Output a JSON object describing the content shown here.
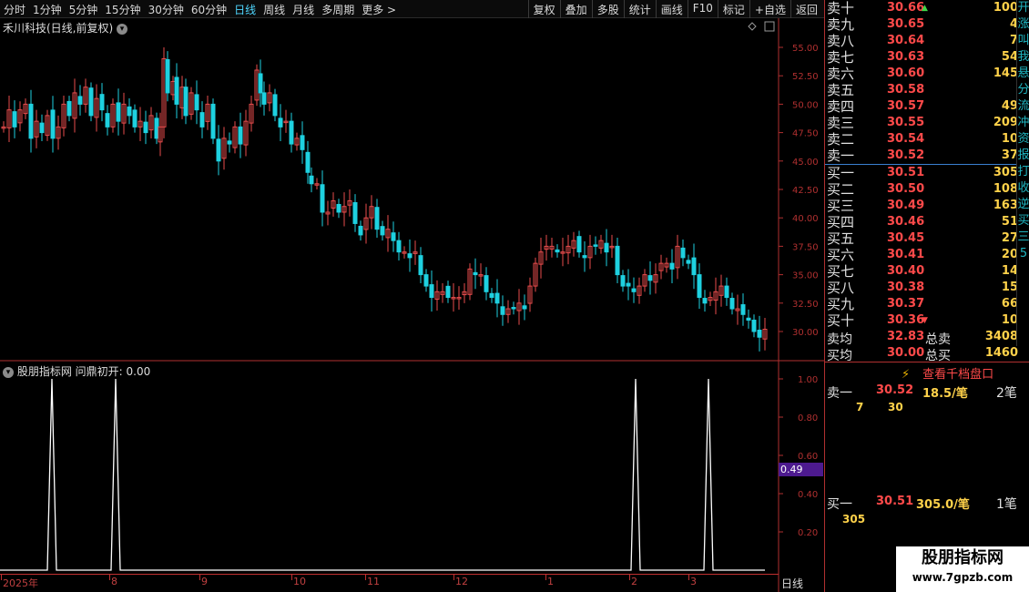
{
  "toolbar": {
    "left": [
      "分时",
      "1分钟",
      "5分钟",
      "15分钟",
      "30分钟",
      "60分钟",
      "日线",
      "周线",
      "月线",
      "多周期",
      "更多 >"
    ],
    "active": "日线",
    "right": [
      "复权",
      "叠加",
      "多股",
      "统计",
      "画线",
      "F10",
      "标记",
      "+自选",
      "返回"
    ]
  },
  "chart": {
    "title": "禾川科技(日线,前复权)",
    "y_labels": [
      "55.00",
      "52.50",
      "50.00",
      "47.50",
      "45.00",
      "42.50",
      "40.00",
      "37.50",
      "35.00",
      "32.50",
      "30.00"
    ],
    "ind_y_labels": [
      "1.00",
      "0.80",
      "0.60",
      "0.40",
      "0.20"
    ]
  },
  "indicator": {
    "title": "股朋指标网",
    "name": "问鼎初开:",
    "value": "0.00",
    "tag": "0.49"
  },
  "x_axis": {
    "labels": [
      "2025年",
      "8",
      "9",
      "10",
      "11",
      "12",
      "1",
      "2",
      "3"
    ],
    "period": "日线"
  },
  "order_book": {
    "asks": [
      {
        "name": "卖十",
        "price": "30.66",
        "vol": "100",
        "mark": "up"
      },
      {
        "name": "卖九",
        "price": "30.65",
        "vol": "4"
      },
      {
        "name": "卖八",
        "price": "30.64",
        "vol": "7"
      },
      {
        "name": "卖七",
        "price": "30.63",
        "vol": "54"
      },
      {
        "name": "卖六",
        "price": "30.60",
        "vol": "145"
      },
      {
        "name": "卖五",
        "price": "30.58",
        "vol": ""
      },
      {
        "name": "卖四",
        "price": "30.57",
        "vol": "49"
      },
      {
        "name": "卖三",
        "price": "30.55",
        "vol": "209"
      },
      {
        "name": "卖二",
        "price": "30.54",
        "vol": "10"
      },
      {
        "name": "卖一",
        "price": "30.52",
        "vol": "37"
      }
    ],
    "bids": [
      {
        "name": "买一",
        "price": "30.51",
        "vol": "305"
      },
      {
        "name": "买二",
        "price": "30.50",
        "vol": "108"
      },
      {
        "name": "买三",
        "price": "30.49",
        "vol": "163"
      },
      {
        "name": "买四",
        "price": "30.46",
        "vol": "51"
      },
      {
        "name": "买五",
        "price": "30.45",
        "vol": "27"
      },
      {
        "name": "买六",
        "price": "30.41",
        "vol": "20"
      },
      {
        "name": "买七",
        "price": "30.40",
        "vol": "14"
      },
      {
        "name": "买八",
        "price": "30.38",
        "vol": "15"
      },
      {
        "name": "买九",
        "price": "30.37",
        "vol": "66"
      },
      {
        "name": "买十",
        "price": "30.36",
        "vol": "10",
        "mark": "down"
      }
    ],
    "sell_avg_label": "卖均",
    "sell_avg": "32.83",
    "total_sell_label": "总卖",
    "total_sell": "3408",
    "buy_avg_label": "买均",
    "buy_avg": "30.00",
    "total_buy_label": "总买",
    "total_buy": "1460"
  },
  "queue": {
    "button": "查看千档盘口",
    "sell1_label": "卖一",
    "sell1_price": "30.52",
    "sell1_avg": "18.5/笔",
    "sell1_count": "2笔",
    "sell1_orders": [
      "7",
      "30"
    ],
    "buy1_label": "买一",
    "buy1_price": "30.51",
    "buy1_avg": "305.0/笔",
    "buy1_count": "1笔",
    "buy1_orders": [
      "305"
    ]
  },
  "edge_chars": [
    "开",
    "涨",
    "叫",
    "我",
    "悬",
    "分",
    "流",
    "冲",
    "资",
    "报",
    "打",
    "收",
    "逆",
    "买",
    "三",
    "5"
  ],
  "watermark": {
    "line1": "股朋指标网",
    "line2": "www.7gpzb.com"
  },
  "colors": {
    "up": "#e84c4c",
    "down": "#1ed1e0",
    "axis": "#b03030"
  }
}
